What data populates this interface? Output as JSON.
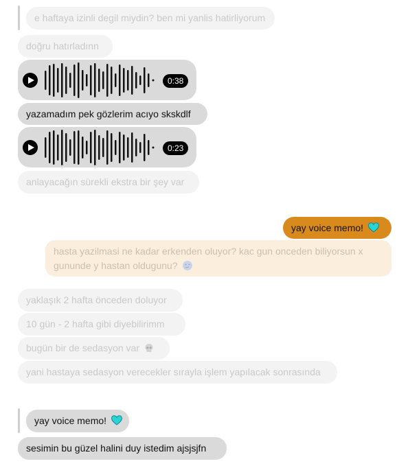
{
  "messages": {
    "m1": "e haftaya izinli degil miydin? ben mi yanlis hatirliyorum",
    "m2": "doğru hatırladınn",
    "voice1_duration": "0:38",
    "m3": "yazamadım pek gözlerim acıyo skskdlf",
    "voice2_duration": "0:23",
    "m4": "anlayacağın sürekli ekstra bir şey var",
    "sent_reply": "yay voice memo!",
    "quoted": "hasta yazilmasi ne kadar erkenden oluyor? kac gun onceden biliyorsun x gununde y hastan oldugunu?",
    "quoted_line1": "hasta yazilmasi ne kadar erkenden oluyor? kac gun onceden biliyorsun x",
    "quoted_line2": "gununde y hastan oldugunu?",
    "m5": "yaklaşık 2 hafta önceden doluyor",
    "m6": "10 gün - 2 hafta gibi diyebilirimm",
    "m7": "bugün bir de sedasyon var",
    "m8": "yani hastaya sedasyon verecekler sırayla işlem yapılacak sonrasında",
    "quoted2": "yay voice memo!",
    "m9": "sesimin bu güzel halini duy istedim ajsjsjfn"
  },
  "icons": {
    "heart": "turquoise-heart-icon",
    "thinking": "thinking-face-icon",
    "skull": "skull-icon"
  },
  "colors": {
    "sent_bubble": "#d98a1c",
    "quoted_bubble": "#fbeedc",
    "received_bubble": "#dadada",
    "faded_bubble": "#f3f3f3",
    "heart": "#2bd4d4"
  }
}
